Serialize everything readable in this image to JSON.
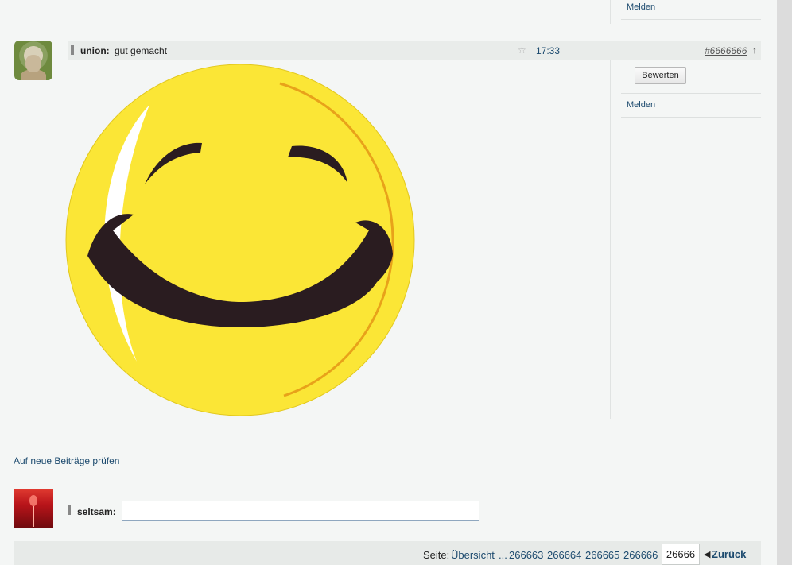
{
  "previous_post": {
    "report_label": "Melden"
  },
  "post": {
    "author": "union:",
    "message": "gut gemacht",
    "time": "17:33",
    "post_number": "#6666666",
    "rate_label": "Bewerten",
    "report_label": "Melden",
    "star_icon": "star-icon",
    "up_icon": "arrow-up-icon",
    "image_icon": "smiley-image",
    "colors": {
      "smiley": "#fbe636",
      "stroke": "#2a1c20",
      "rim": "#e8a21a"
    }
  },
  "check_new_label": "Auf neue Beiträge prüfen",
  "reply": {
    "author": "seltsam:",
    "value": ""
  },
  "pager": {
    "label": "Seite:",
    "overview": "Übersicht",
    "ellipsis": "...",
    "pages": [
      "266663",
      "266664",
      "266665",
      "266666"
    ],
    "current": "26666",
    "back_label": "Zurück",
    "back_icon": "triangle-left-icon"
  }
}
